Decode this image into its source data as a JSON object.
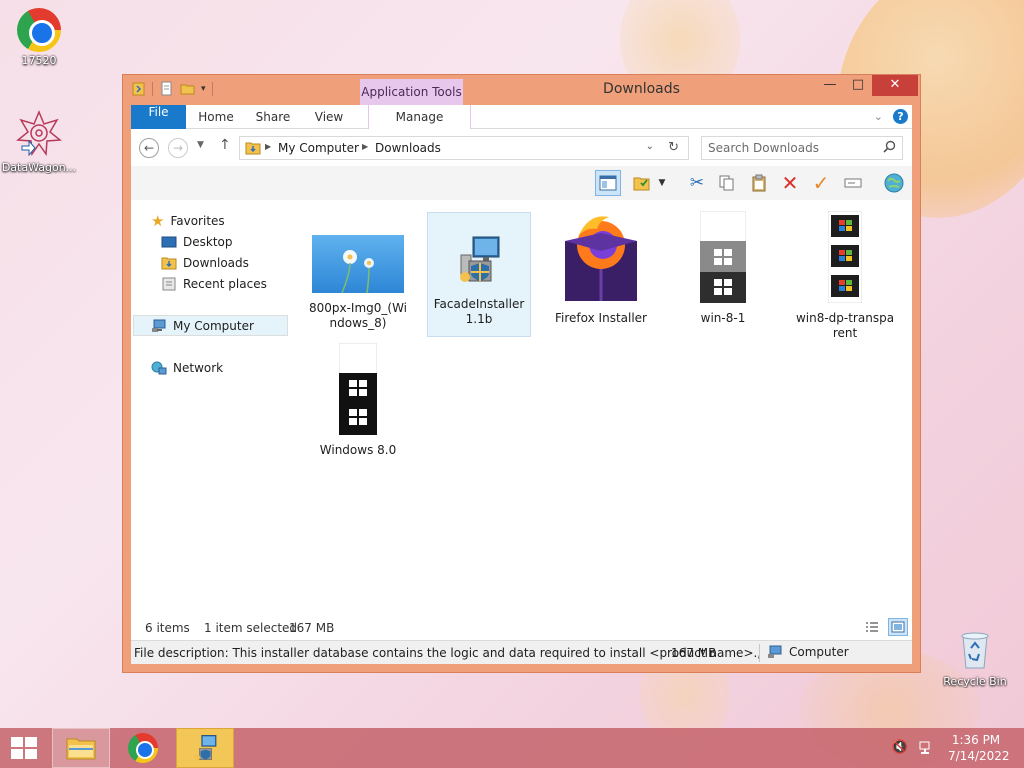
{
  "desktop": {
    "icons": [
      {
        "label": "17520"
      },
      {
        "label": "DataWagon..."
      },
      {
        "label": "Recycle Bin"
      }
    ]
  },
  "window": {
    "title": "Downloads",
    "contextual_tab_group": "Application Tools",
    "ribbon_tabs": {
      "file": "File",
      "home": "Home",
      "share": "Share",
      "view": "View",
      "manage": "Manage"
    },
    "address": {
      "crumbs": [
        "My Computer",
        "Downloads"
      ]
    },
    "search": {
      "placeholder": "Search Downloads"
    },
    "nav_pane": {
      "favorites": "Favorites",
      "desktop": "Desktop",
      "downloads": "Downloads",
      "recent": "Recent places",
      "computer": "My Computer",
      "network": "Network"
    },
    "files": [
      {
        "name": "800px-Img0_(Windows_8)"
      },
      {
        "name": "FacadeInstaller1.1b"
      },
      {
        "name": "Firefox Installer"
      },
      {
        "name": "win-8-1"
      },
      {
        "name": "win8-dp-transparent"
      },
      {
        "name": "Windows 8.0"
      }
    ],
    "status": {
      "items": "6 items",
      "selected": "1 item selected",
      "size": "167 MB"
    },
    "details_bar": {
      "description": "File description: This installer database contains the logic and data required to install <product name>.,",
      "size": "167 MB",
      "location": "Computer"
    }
  },
  "taskbar": {
    "time": "1:36 PM",
    "date": "7/14/2022"
  },
  "colors": {
    "file_tab": "#1979ca",
    "titlebar": "#ef9f7a",
    "close_button": "#c7403a",
    "context_tab": "#e8c7ec",
    "taskbar": "#c6676e"
  }
}
